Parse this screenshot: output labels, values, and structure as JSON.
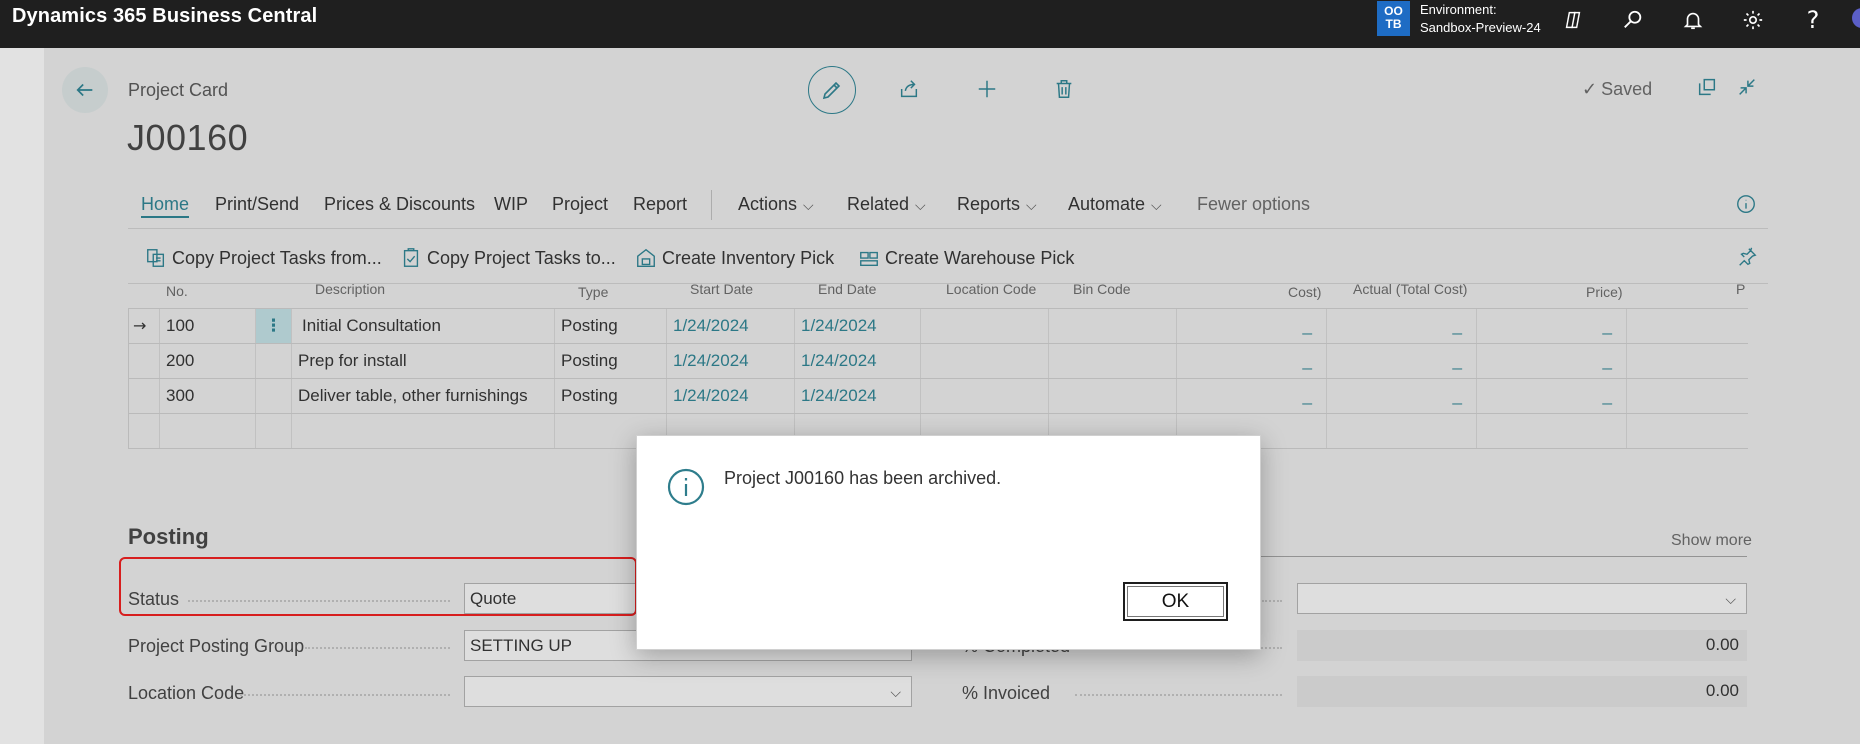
{
  "app": {
    "title": "Dynamics 365 Business Central",
    "env_initials": "OO\nTB",
    "env_label": "Environment:",
    "env_name": "Sandbox-Preview-24",
    "help": "?"
  },
  "page": {
    "caption": "Project Card",
    "record_no": "J00160",
    "saved_label": "Saved"
  },
  "menu": {
    "items": [
      "Home",
      "Print/Send",
      "Prices & Discounts",
      "WIP",
      "Project",
      "Report"
    ],
    "dropdowns": [
      "Actions",
      "Related",
      "Reports",
      "Automate"
    ],
    "fewer": "Fewer options"
  },
  "actions": [
    "Copy Project Tasks from...",
    "Copy Project Tasks to...",
    "Create Inventory Pick",
    "Create Warehouse Pick"
  ],
  "grid": {
    "headers": [
      "No.",
      "Description",
      "Type",
      "Start Date",
      "End Date",
      "Location Code",
      "Bin Code",
      "Cost)",
      "Actual (Total Cost)",
      "Price)",
      "P"
    ],
    "rows": [
      {
        "no": "100",
        "desc": "Initial Consultation",
        "type": "Posting",
        "start": "1/24/2024",
        "end": "1/24/2024",
        "c1": "_",
        "c2": "_",
        "c3": "_"
      },
      {
        "no": "200",
        "desc": "Prep for install",
        "type": "Posting",
        "start": "1/24/2024",
        "end": "1/24/2024",
        "c1": "_",
        "c2": "_",
        "c3": "_"
      },
      {
        "no": "300",
        "desc": "Deliver table, other furnishings",
        "type": "Posting",
        "start": "1/24/2024",
        "end": "1/24/2024",
        "c1": "_",
        "c2": "_",
        "c3": "_"
      }
    ],
    "current_row_marker": "→",
    "row_menu": "⋮"
  },
  "posting": {
    "title": "Posting",
    "show_more": "Show more",
    "status_label": "Status",
    "status_value": "Quote",
    "posting_group_label": "Project Posting Group",
    "posting_group_value": "SETTING UP",
    "location_label": "Location Code",
    "location_value": "",
    "completed_label": "% Completed",
    "completed_value": "0.00",
    "invoiced_label": "% Invoiced",
    "invoiced_value": "0.00"
  },
  "dialog": {
    "message": "Project J00160 has been archived.",
    "ok": "OK"
  }
}
